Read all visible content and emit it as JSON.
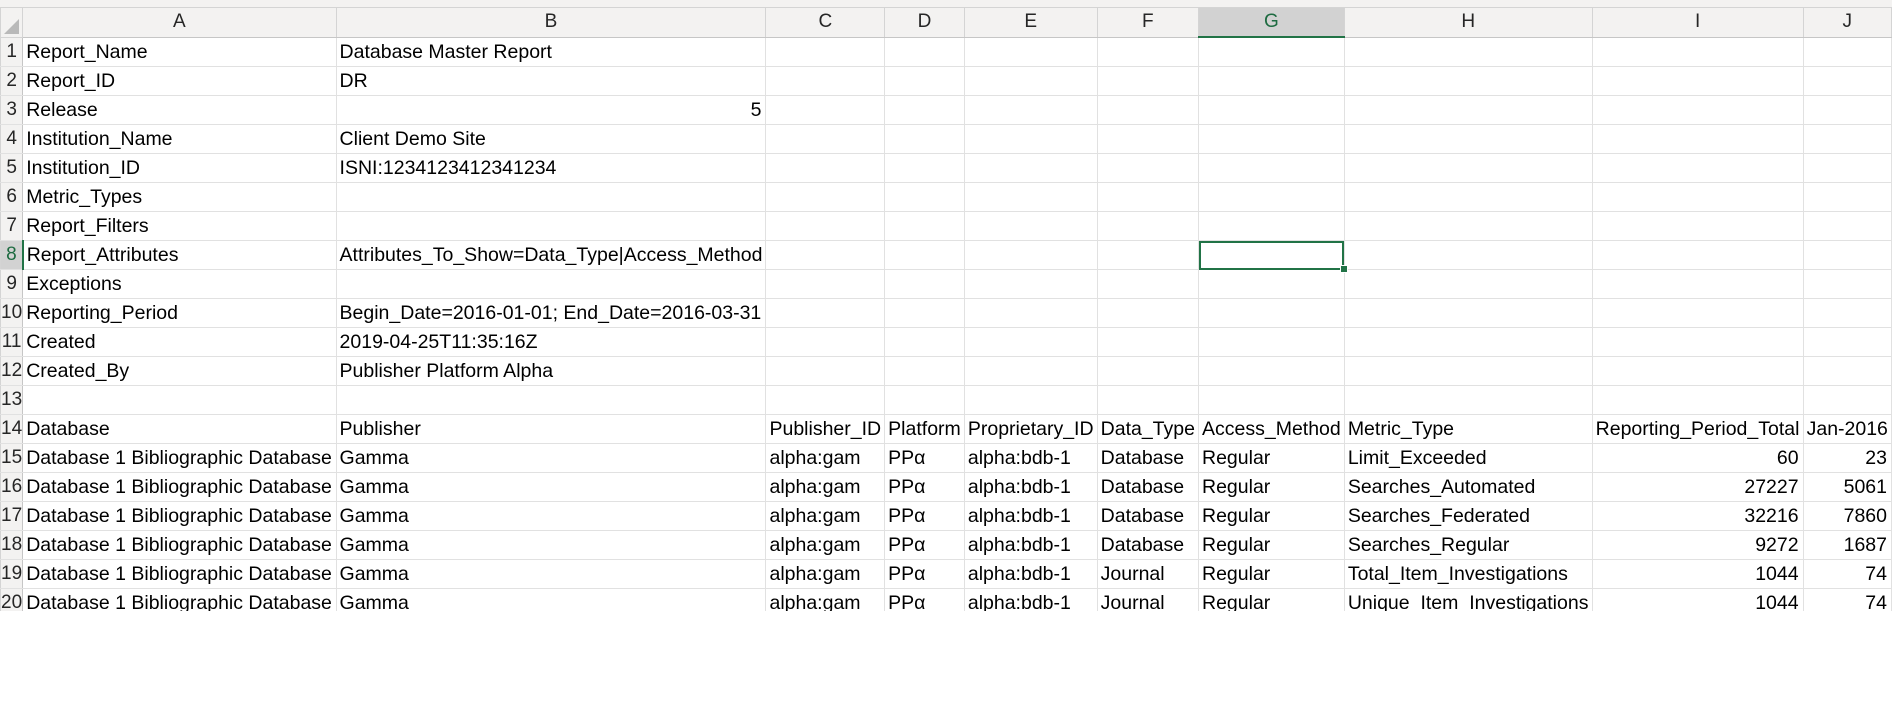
{
  "columns": [
    "A",
    "B",
    "C",
    "D",
    "E",
    "F",
    "G",
    "H",
    "I",
    "J"
  ],
  "selected_column": "G",
  "selected_row": 8,
  "rows": [
    {
      "n": "1",
      "a": "Report_Name",
      "b": "Database Master Report"
    },
    {
      "n": "2",
      "a": "Report_ID",
      "b": "DR"
    },
    {
      "n": "3",
      "a": "Release",
      "b": "5"
    },
    {
      "n": "4",
      "a": "Institution_Name",
      "b": "Client Demo Site"
    },
    {
      "n": "5",
      "a": "Institution_ID",
      "b": "ISNI:1234123412341234"
    },
    {
      "n": "6",
      "a": "Metric_Types",
      "b": ""
    },
    {
      "n": "7",
      "a": "Report_Filters",
      "b": ""
    },
    {
      "n": "8",
      "a": "Report_Attributes",
      "b": "Attributes_To_Show=Data_Type|Access_Method"
    },
    {
      "n": "9",
      "a": "Exceptions",
      "b": ""
    },
    {
      "n": "10",
      "a": "Reporting_Period",
      "b": "Begin_Date=2016-01-01; End_Date=2016-03-31"
    },
    {
      "n": "11",
      "a": "Created",
      "b": "2019-04-25T11:35:16Z"
    },
    {
      "n": "12",
      "a": "Created_By",
      "b": "Publisher Platform Alpha"
    },
    {
      "n": "13",
      "a": "",
      "b": ""
    }
  ],
  "header_row": {
    "n": "14",
    "cells": [
      "Database",
      "Publisher",
      "Publisher_ID",
      "Platform",
      "Proprietary_ID",
      "Data_Type",
      "Access_Method",
      "Metric_Type",
      "Reporting_Period_Total",
      "Jan-2016"
    ]
  },
  "data_rows": [
    {
      "n": "15",
      "cells": [
        "Database 1 Bibliographic Database",
        "Gamma",
        "alpha:gam",
        "PPα",
        "alpha:bdb-1",
        "Database",
        "Regular",
        "Limit_Exceeded",
        "60",
        "23"
      ]
    },
    {
      "n": "16",
      "cells": [
        "Database 1 Bibliographic Database",
        "Gamma",
        "alpha:gam",
        "PPα",
        "alpha:bdb-1",
        "Database",
        "Regular",
        "Searches_Automated",
        "27227",
        "5061"
      ]
    },
    {
      "n": "17",
      "cells": [
        "Database 1 Bibliographic Database",
        "Gamma",
        "alpha:gam",
        "PPα",
        "alpha:bdb-1",
        "Database",
        "Regular",
        "Searches_Federated",
        "32216",
        "7860"
      ]
    },
    {
      "n": "18",
      "cells": [
        "Database 1 Bibliographic Database",
        "Gamma",
        "alpha:gam",
        "PPα",
        "alpha:bdb-1",
        "Database",
        "Regular",
        "Searches_Regular",
        "9272",
        "1687"
      ]
    },
    {
      "n": "19",
      "cells": [
        "Database 1 Bibliographic Database",
        "Gamma",
        "alpha:gam",
        "PPα",
        "alpha:bdb-1",
        "Journal",
        "Regular",
        "Total_Item_Investigations",
        "1044",
        "74"
      ]
    },
    {
      "n": "20",
      "cells": [
        "Database 1 Bibliographic Database",
        "Gamma",
        "alpha:gam",
        "PPα",
        "alpha:bdb-1",
        "Journal",
        "Regular",
        "Unique_Item_Investigations",
        "1044",
        "74"
      ]
    }
  ],
  "colors": {
    "selection_green": "#217346",
    "header_bg": "#f3f2f1",
    "gridline": "#e1e1e1"
  }
}
